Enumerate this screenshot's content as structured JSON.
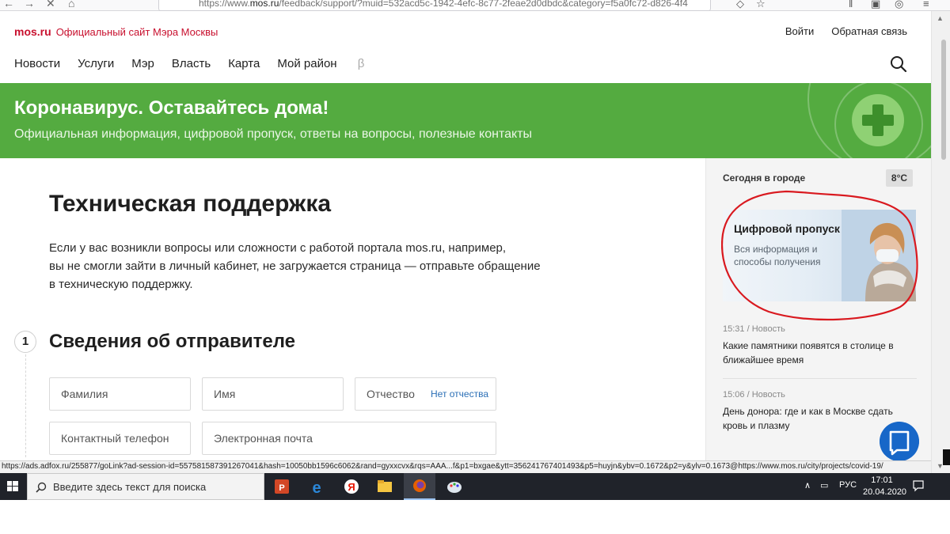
{
  "browser": {
    "url_prefix": "https://www.",
    "url_domain": "mos.ru",
    "url_rest": "/feedback/support/?muid=532acd5c-1942-4efc-8c77-2feae2d0dbdc&category=f5a0fc72-d826-4f4"
  },
  "header": {
    "logo": "mos.ru",
    "tagline": "Официальный сайт Мэра Москвы",
    "login": "Войти",
    "feedback": "Обратная связь",
    "nav": [
      "Новости",
      "Услуги",
      "Мэр",
      "Власть",
      "Карта",
      "Мой район"
    ],
    "nav_beta": "β"
  },
  "banner": {
    "title": "Коронавирус. Оставайтесь дома!",
    "subtitle": "Официальная информация, цифровой пропуск, ответы на вопросы, полезные контакты"
  },
  "main": {
    "title": "Техническая поддержка",
    "intro_lines": [
      "Если у вас возникли вопросы или сложности с работой портала mos.ru, например,",
      "вы не смогли зайти в личный кабинет, не загружается страница — отправьте обращение",
      "в техническую поддержку."
    ],
    "step_number": "1",
    "step_title": "Сведения об отправителе",
    "fields": {
      "last_name": "Фамилия",
      "first_name": "Имя",
      "patronymic": "Отчество",
      "no_patronymic": "Нет отчества",
      "phone": "Контактный телефон",
      "email": "Электронная почта"
    }
  },
  "sidebar": {
    "today": "Сегодня в городе",
    "temperature": "8°C",
    "promo_title": "Цифровой пропуск",
    "promo_subtitle": "Вся информация и способы получения",
    "news": [
      {
        "time": "15:31",
        "type": "Новость",
        "headline": "Какие памятники появятся в столице в ближайшее время"
      },
      {
        "time": "15:06",
        "type": "Новость",
        "headline": "День донора: где и как в Москве сдать кровь и плазму"
      }
    ]
  },
  "status_link": "https://ads.adfox.ru/255877/goLink?ad-session-id=557581587391267041&hash=10050bb1596c6062&rand=gyxxcvx&rqs=AAA...f&p1=bxgae&ytt=356241767401493&p5=huyjn&ybv=0.1672&p2=y&ylv=0.1673@https://www.mos.ru/city/projects/covid-19/",
  "taskbar": {
    "search_placeholder": "Введите здесь текст для поиска",
    "language": "РУС",
    "time": "17:01",
    "date": "20.04.2020"
  },
  "colors": {
    "brand_red": "#c8102e",
    "banner_green": "#54ab40",
    "link_blue": "#2b6fb6",
    "chat_blue": "#1767c8",
    "annotation_red": "#d9191f"
  }
}
